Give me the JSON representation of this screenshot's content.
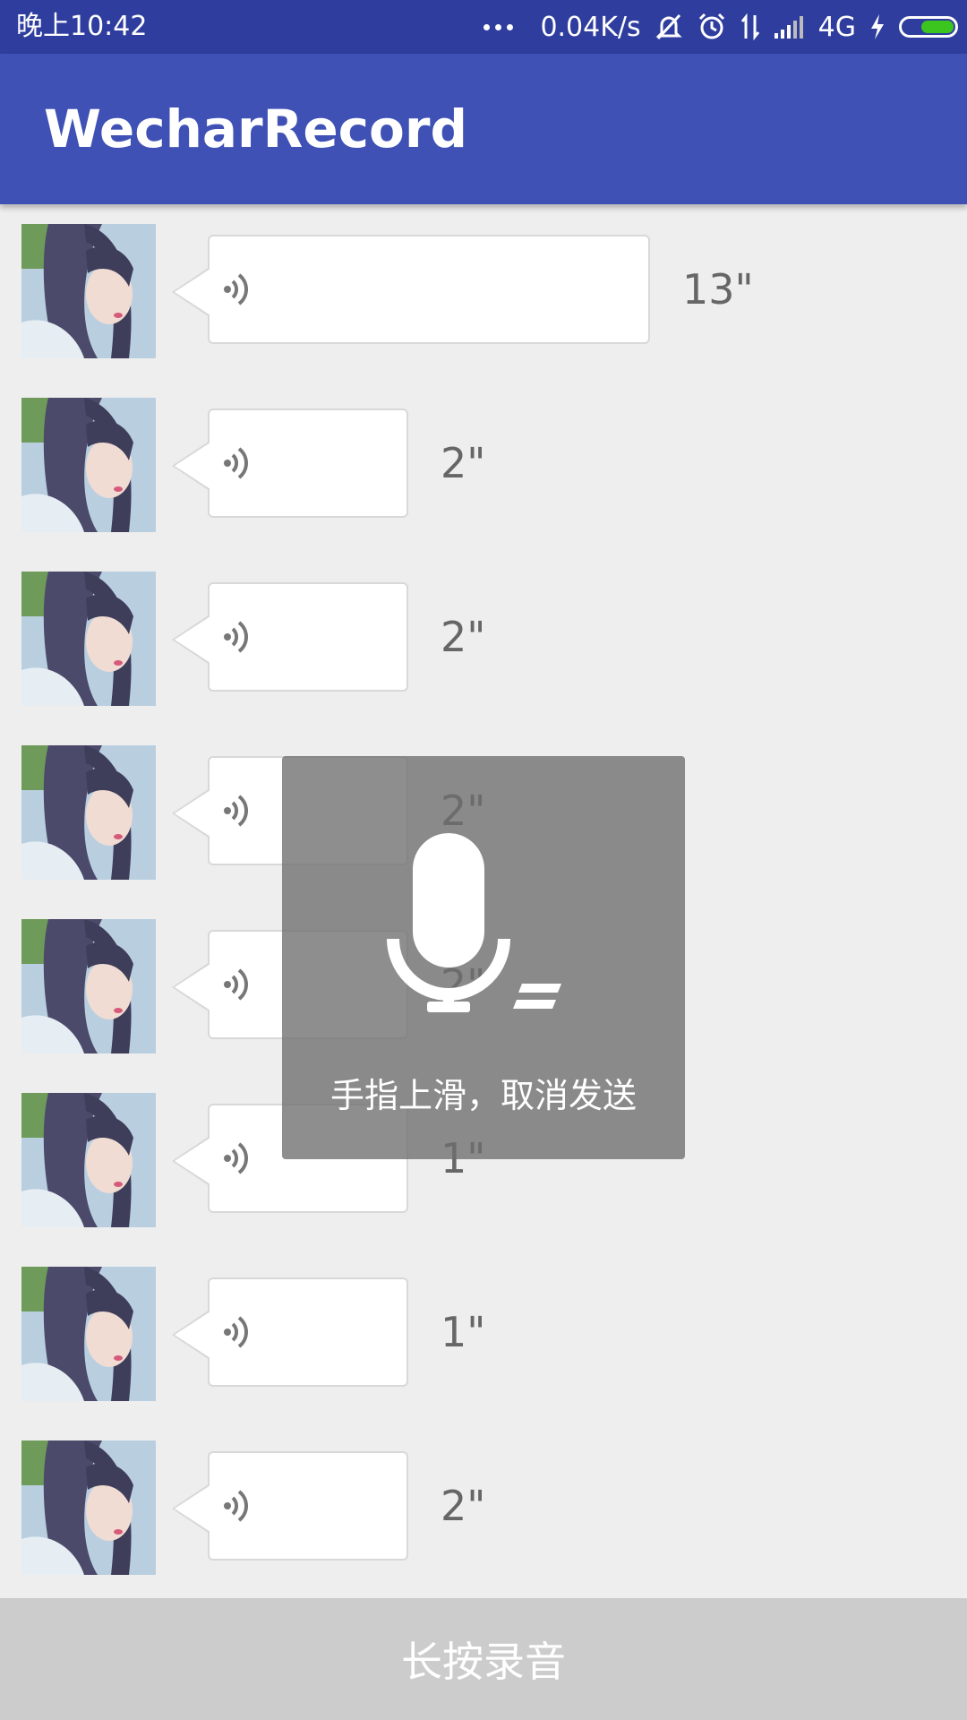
{
  "status_bar": {
    "time": "晚上10:42",
    "net_speed": "0.04K/s",
    "network": "4G",
    "battery_color": "#3CC51F"
  },
  "app_bar": {
    "title": "WecharRecord",
    "color": "#3F51B5"
  },
  "messages": [
    {
      "duration": "13\""
    },
    {
      "duration": "2\""
    },
    {
      "duration": "2\""
    },
    {
      "duration": "2\""
    },
    {
      "duration": "2\""
    },
    {
      "duration": "1\""
    },
    {
      "duration": "1\""
    },
    {
      "duration": "2\""
    }
  ],
  "record_overlay": {
    "icon": "microphone-icon",
    "hint": "手指上滑，取消发送"
  },
  "record_button": {
    "label": "长按录音"
  }
}
